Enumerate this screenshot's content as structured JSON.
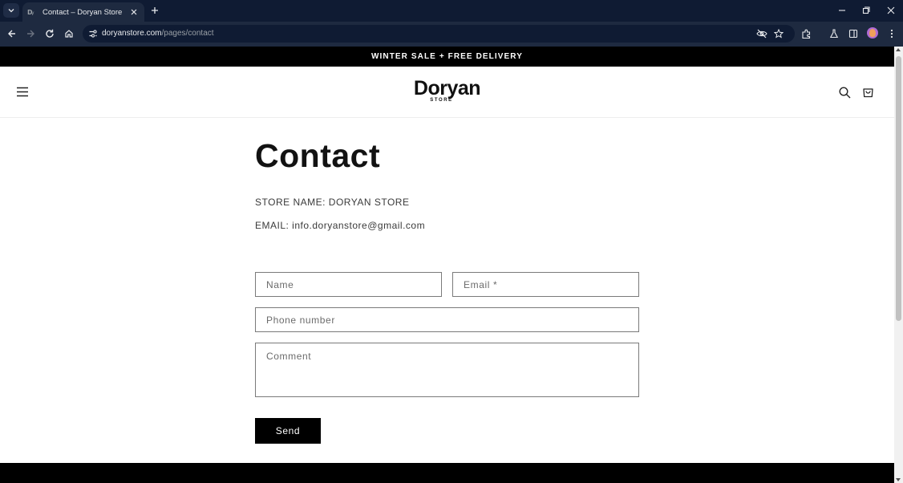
{
  "browser": {
    "tab_title": "Contact – Doryan Store",
    "url_host": "doryanstore.com",
    "url_path": "/pages/contact"
  },
  "announcement": "WINTER SALE + FREE DELIVERY",
  "logo": {
    "main": "Doryan",
    "sub": "STORE"
  },
  "page_title": "Contact",
  "store_name": "STORE NAME: DORYAN STORE",
  "email_info": "EMAIL: info.doryanstore@gmail.com",
  "form": {
    "name_placeholder": "Name",
    "email_placeholder": "Email *",
    "phone_placeholder": "Phone number",
    "comment_placeholder": "Comment",
    "send_label": "Send"
  },
  "colors": {
    "chrome_dark": "#0f1b33",
    "chrome_toolbar": "#1e2a40",
    "announce_bg": "#000000",
    "button_bg": "#000000"
  },
  "icons": [
    "tab-search-icon",
    "close-icon",
    "new-tab-icon",
    "minimize-icon",
    "restore-icon",
    "back-icon",
    "forward-icon",
    "reload-icon",
    "home-icon",
    "site-info-icon",
    "eye-off-icon",
    "star-icon",
    "extensions-icon",
    "labs-icon",
    "sidepanel-icon",
    "kebab-menu-icon",
    "hamburger-icon",
    "search-icon",
    "cart-icon"
  ]
}
